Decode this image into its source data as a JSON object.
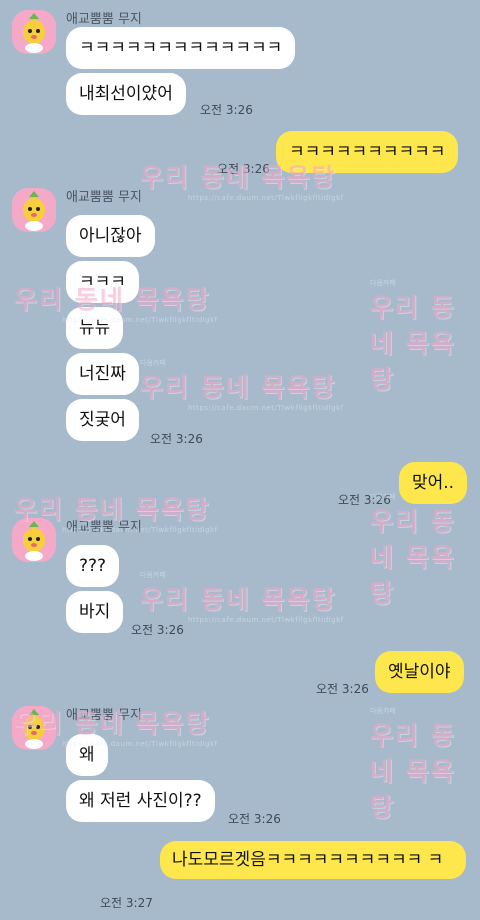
{
  "sender_name": "애교뿜뿜 무지",
  "messages": {
    "m1": "ㅋㅋㅋㅋㅋㅋㅋㅋㅋㅋㅋㅋㅋ",
    "m2": "내최선이얐어",
    "t1": "오전 3:26",
    "m3": "ㅋㅋㅋㅋㅋㅋㅋㅋㅋㅋ",
    "t2": "오전 3:26",
    "m4": "아니잖아",
    "m5": "ㅋㅋㅋ",
    "m6": "뉴뉴",
    "m7": "너진짜",
    "m8": "짓궂어",
    "t3": "오전 3:26",
    "m9": "맞어..",
    "t4": "오전 3:26",
    "m10": "???",
    "m11": "바지",
    "t5": "오전 3:26",
    "m12": "옛날이야",
    "t6": "오전 3:26",
    "m13": "왜",
    "m14": "왜 저런 사진이??",
    "t7": "오전 3:26",
    "m15": "나도모르겟음ㅋㅋㅋㅋㅋㅋㅋㅋㅋㅋ ㅋ",
    "t8": "오전 3:27"
  },
  "watermark": {
    "title": "우리 동네 목욕탕",
    "label": "다음카페",
    "url": "https://cafe.daum.net/Tlwkfllgkfltidlgkf"
  },
  "colors": {
    "background": "#a7bacc",
    "incoming_bubble": "#ffffff",
    "outgoing_bubble": "#fde74c",
    "avatar_bg": "#f5a9c8"
  },
  "icons": {
    "avatar": "muzi-pineapple-character-icon"
  }
}
